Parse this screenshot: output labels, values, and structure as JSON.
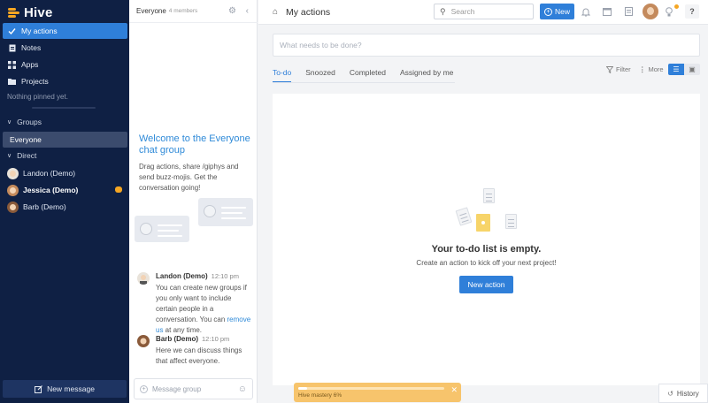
{
  "app": {
    "name": "Hive"
  },
  "colors": {
    "sidebar": "#0f2044",
    "accent": "#2f7fd9",
    "brand": "#f5a623",
    "mastery": "#f7c46c"
  },
  "sidebar": {
    "nav": [
      {
        "label": "My actions",
        "icon": "check-icon",
        "active": true
      },
      {
        "label": "Notes",
        "icon": "note-icon"
      },
      {
        "label": "Apps",
        "icon": "grid-icon"
      },
      {
        "label": "Projects",
        "icon": "folder-icon"
      }
    ],
    "pinned_empty": "Nothing pinned yet.",
    "groups_header": "Groups",
    "groups": [
      {
        "label": "Everyone",
        "active": true
      }
    ],
    "direct_header": "Direct",
    "direct": [
      {
        "label": "Landon (Demo)"
      },
      {
        "label": "Jessica (Demo)",
        "bold": true,
        "badge": true
      },
      {
        "label": "Barb (Demo)"
      }
    ],
    "new_message": "New message"
  },
  "chat": {
    "title": "Everyone",
    "members": "4 members",
    "welcome_title": "Welcome to the Everyone chat group",
    "welcome_body": "Drag actions, share /giphys and send buzz-mojis. Get the conversation going!",
    "messages": [
      {
        "author": "Landon (Demo)",
        "time": "12:10 pm",
        "body_before": "You can create new groups if you only want to include certain people in a conversation. You can ",
        "link": "remove us",
        "body_after": " at any time."
      },
      {
        "author": "Barb (Demo)",
        "time": "12:10 pm",
        "body": "Here we can discuss things that affect everyone."
      }
    ],
    "composer_placeholder": "Message group"
  },
  "topbar": {
    "title": "My actions",
    "search_placeholder": "Search",
    "new_label": "New",
    "help": "?"
  },
  "main": {
    "todo_placeholder": "What needs to be done?",
    "tabs": [
      {
        "label": "To-do",
        "active": true
      },
      {
        "label": "Snoozed"
      },
      {
        "label": "Completed"
      },
      {
        "label": "Assigned by me"
      }
    ],
    "filter_label": "Filter",
    "more_label": "More",
    "empty_title": "Your to-do list is empty.",
    "empty_sub": "Create an action to kick off your next project!",
    "new_action_label": "New action"
  },
  "mastery": {
    "label": "Hive mastery 6%",
    "progress": 0.06
  },
  "history": {
    "label": "History"
  }
}
